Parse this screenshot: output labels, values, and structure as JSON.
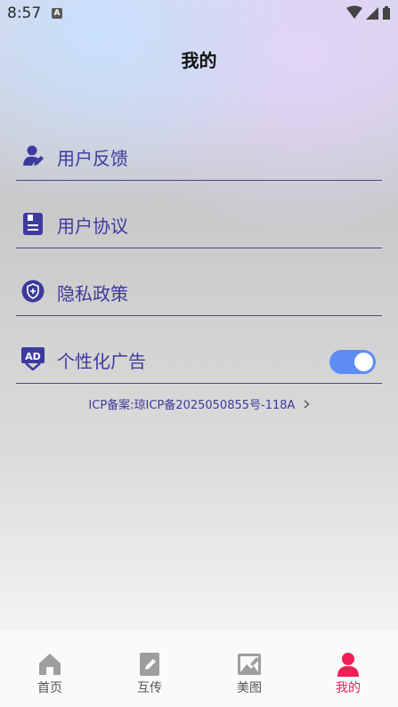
{
  "status_bar": {
    "time": "8:57",
    "notification_icon": "A"
  },
  "page": {
    "title": "我的"
  },
  "menu": [
    {
      "label": "用户反馈",
      "icon": "user-feedback-icon"
    },
    {
      "label": "用户协议",
      "icon": "document-icon"
    },
    {
      "label": "隐私政策",
      "icon": "shield-icon"
    },
    {
      "label": "个性化广告",
      "icon": "ad-icon",
      "toggle": "on"
    }
  ],
  "icp": {
    "text": "ICP备案:琼ICP备2025050855号-118A"
  },
  "tabs": [
    {
      "label": "首页",
      "icon": "home-icon"
    },
    {
      "label": "互传",
      "icon": "transfer-icon"
    },
    {
      "label": "美图",
      "icon": "image-icon"
    },
    {
      "label": "我的",
      "icon": "profile-icon",
      "active": true
    }
  ],
  "colors": {
    "accent": "#3d3a9e",
    "tab_active": "#ef2056",
    "toggle_on": "#5d8cf5",
    "divider": "#4b4785"
  }
}
